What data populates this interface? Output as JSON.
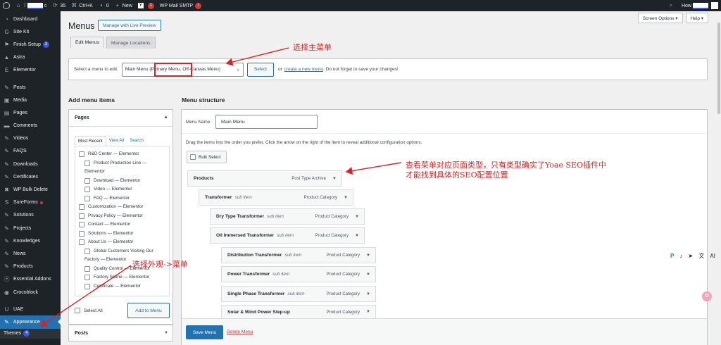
{
  "admin_bar": {
    "site_fragment": "c",
    "updates_count": "35",
    "search_shortcut": "Ctrl+K",
    "comments_count": "0",
    "new_label": "New",
    "yoast_badge": "1",
    "smtp_label": "WP Mail SMTP",
    "smtp_badge": "!",
    "howdy": "How"
  },
  "sidebar": {
    "items": [
      {
        "label": "Dashboard",
        "icon": "dashboard-icon"
      },
      {
        "label": "Site Kit",
        "icon": "sitekit-icon"
      },
      {
        "label": "Finish Setup",
        "icon": "setup-icon",
        "badge": "3"
      },
      {
        "label": "Astra",
        "icon": "astra-icon"
      },
      {
        "label": "Elementor",
        "icon": "elementor-icon"
      },
      {
        "label": "Posts",
        "icon": "pin-icon"
      },
      {
        "label": "Media",
        "icon": "media-icon"
      },
      {
        "label": "Pages",
        "icon": "pages-icon"
      },
      {
        "label": "Comments",
        "icon": "comments-icon"
      },
      {
        "label": "Videos",
        "icon": "pin-icon"
      },
      {
        "label": "FAQS",
        "icon": "pin-icon"
      },
      {
        "label": "Downloads",
        "icon": "pin-icon"
      },
      {
        "label": "Certificates",
        "icon": "pin-icon"
      },
      {
        "label": "WP Bulk Delete",
        "icon": "delete-icon"
      },
      {
        "label": "SureForms",
        "icon": "sureforms-icon"
      },
      {
        "label": "Solutions",
        "icon": "pin-icon"
      },
      {
        "label": "Projects",
        "icon": "pin-icon"
      },
      {
        "label": "Knowledges",
        "icon": "pin-icon"
      },
      {
        "label": "News",
        "icon": "pin-icon"
      },
      {
        "label": "Products",
        "icon": "pin-icon"
      },
      {
        "label": "Essential Addons",
        "icon": "ea-icon"
      },
      {
        "label": "Crocoblock",
        "icon": "croco-icon"
      },
      {
        "label": "UAE",
        "icon": "uae-icon"
      },
      {
        "label": "Appearance",
        "icon": "appearance-icon"
      }
    ],
    "submenu_themes": "Themes",
    "submenu_themes_badge": "4"
  },
  "screen_options": "Screen Options ▾",
  "help": "Help ▾",
  "page_title": "Menus",
  "live_preview": "Manage with Live Preview",
  "tabs": [
    "Edit Menus",
    "Manage Locations"
  ],
  "select_bar": {
    "label": "Select a menu to edit:",
    "selected": "Main Menu (Primary Menu, Off-Canvas Menu)",
    "select_btn": "Select",
    "or": "or",
    "create_link": "create a new menu",
    "suffix": ". Do not forget to save your changes!"
  },
  "add_items_heading": "Add menu items",
  "pages_panel": {
    "title": "Pages",
    "tabs": [
      "Most Recent",
      "View All",
      "Search"
    ],
    "items": [
      {
        "text": "R&D Center — Elementor",
        "depth": 0
      },
      {
        "text": "Product Production Line —",
        "depth": 1
      },
      {
        "text": "Elementor",
        "depth": 1,
        "cont": true
      },
      {
        "text": "Download — Elementor",
        "depth": 1
      },
      {
        "text": "Video — Elementor",
        "depth": 1
      },
      {
        "text": "FAQ — Elementor",
        "depth": 1
      },
      {
        "text": "Customization — Elementor",
        "depth": 0
      },
      {
        "text": "Privacy Policy — Elementor",
        "depth": 0
      },
      {
        "text": "Contact — Elementor",
        "depth": 0
      },
      {
        "text": "Solutions — Elementor",
        "depth": 0
      },
      {
        "text": "About Us — Elementor",
        "depth": 0
      },
      {
        "text": "Global Customers Visiting Our",
        "depth": 1
      },
      {
        "text": "Factory — Elementor",
        "depth": 1,
        "cont": true
      },
      {
        "text": "Quality Control — Elementor",
        "depth": 1
      },
      {
        "text": "Factory Scene — Elementor",
        "depth": 1
      },
      {
        "text": "Certificate — Elementor",
        "depth": 1
      }
    ],
    "select_all": "Select All",
    "add_btn": "Add to Menu"
  },
  "posts_panel": "Posts",
  "structure": {
    "heading": "Menu structure",
    "name_label": "Menu Name",
    "name_value": "Main Menu",
    "instructions": "Drag the items into the order you prefer. Click the arrow on the right of the item to reveal additional configuration options.",
    "bulk_select": "Bulk Select",
    "items": [
      {
        "title": "Products",
        "sub": "",
        "type": "Post Type Archive"
      },
      {
        "title": "Transformer",
        "sub": "sub item",
        "type": "Product Category"
      },
      {
        "title": "Dry Type Transformer",
        "sub": "sub item",
        "type": "Product Category"
      },
      {
        "title": "Oil Immersed Transformer",
        "sub": "sub item",
        "type": "Product Category"
      },
      {
        "title": "Distribution Transformer",
        "sub": "sub item",
        "type": "Product Category"
      },
      {
        "title": "Power Transformer",
        "sub": "sub item",
        "type": "Product Category"
      },
      {
        "title": "Single Phase Transformer",
        "sub": "sub item",
        "type": "Product Category"
      },
      {
        "title": "Solar & Wind Power Step-up",
        "sub": "",
        "type": "Product Category"
      }
    ],
    "save_btn": "Save Menu",
    "delete_link": "Delete Menu"
  },
  "annotations": {
    "select_main_menu": "选择主菜单",
    "menu_type_line1": "查看菜单对应页面类型，只有类型确实了Yoae SEO插件中",
    "menu_type_line2": "才能找到具体的SEO配置位置",
    "appearance_menu": "选择外观->菜单"
  },
  "colors": {
    "admin_dark": "#1d2327",
    "accent": "#2271b1",
    "annotation_red": "#e02020",
    "danger": "#d63638"
  }
}
